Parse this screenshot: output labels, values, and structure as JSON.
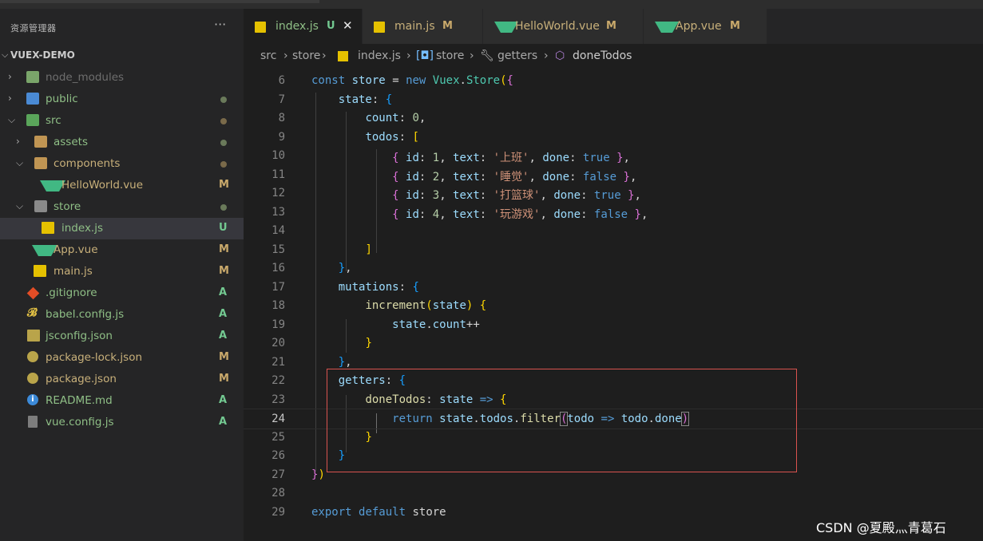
{
  "sidebar": {
    "title": "资源管理器",
    "more": "···",
    "root": "VUEX-DEMO",
    "items": [
      {
        "label": "node_modules",
        "status": ""
      },
      {
        "label": "public",
        "status": ""
      },
      {
        "label": "src",
        "status": ""
      },
      {
        "label": "assets",
        "status": ""
      },
      {
        "label": "components",
        "status": ""
      },
      {
        "label": "HelloWorld.vue",
        "status": "M"
      },
      {
        "label": "store",
        "status": ""
      },
      {
        "label": "index.js",
        "status": "U"
      },
      {
        "label": "App.vue",
        "status": "M"
      },
      {
        "label": "main.js",
        "status": "M"
      },
      {
        "label": ".gitignore",
        "status": "A"
      },
      {
        "label": "babel.config.js",
        "status": "A"
      },
      {
        "label": "jsconfig.json",
        "status": "A"
      },
      {
        "label": "package-lock.json",
        "status": "M"
      },
      {
        "label": "package.json",
        "status": "M"
      },
      {
        "label": "README.md",
        "status": "A"
      },
      {
        "label": "vue.config.js",
        "status": "A"
      }
    ]
  },
  "tabs": [
    {
      "label": "index.js",
      "status": "U",
      "close": "✕"
    },
    {
      "label": "main.js",
      "status": "M"
    },
    {
      "label": "HelloWorld.vue",
      "status": "M"
    },
    {
      "label": "App.vue",
      "status": "M"
    }
  ],
  "breadcrumb": [
    "src",
    "store",
    "index.js",
    "store",
    "getters",
    "doneTodos"
  ],
  "editor": {
    "line_numbers": [
      "6",
      "7",
      "8",
      "9",
      "10",
      "11",
      "12",
      "13",
      "14",
      "15",
      "16",
      "17",
      "18",
      "19",
      "20",
      "21",
      "22",
      "23",
      "24",
      "25",
      "26",
      "27",
      "28",
      "29"
    ],
    "todos": [
      {
        "id": "1",
        "text": "'上班'",
        "done": "true"
      },
      {
        "id": "2",
        "text": "'睡觉'",
        "done": "false"
      },
      {
        "id": "3",
        "text": "'打篮球'",
        "done": "true"
      },
      {
        "id": "4",
        "text": "'玩游戏'",
        "done": "false"
      }
    ]
  },
  "watermark": "CSDN @夏殿灬青葛石",
  "colors": {
    "modified": "#c9a96b",
    "untracked": "#73c991",
    "highlight_box": "#d9534f"
  }
}
